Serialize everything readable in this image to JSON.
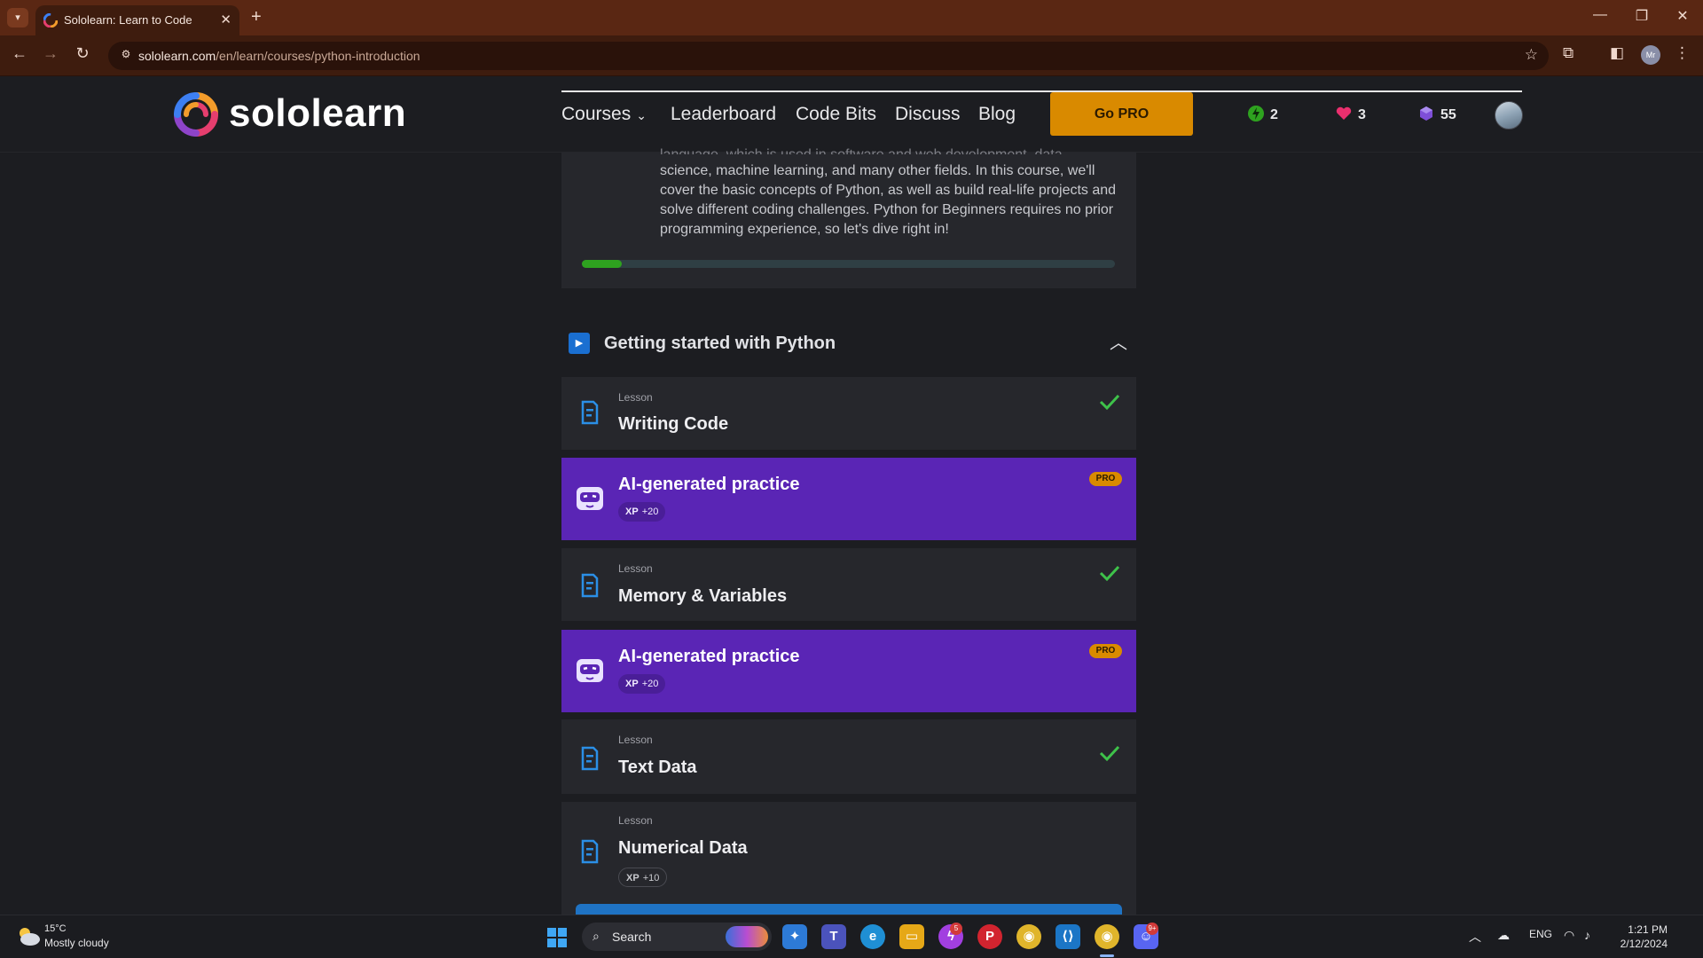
{
  "browser": {
    "tab_title": "Sololearn: Learn to Code",
    "url_host": "sololearn.com",
    "url_path": "/en/learn/courses/python-introduction",
    "profile_initials": "Mr"
  },
  "site": {
    "logo_text": "sololearn",
    "nav": [
      "Courses",
      "Leaderboard",
      "Code Bits",
      "Discuss",
      "Blog"
    ],
    "go_pro_label": "Go PRO",
    "stats": {
      "streak": "2",
      "hearts": "3",
      "gems": "55"
    }
  },
  "course": {
    "intro_cut_line": "language, which is used in software and web development, data",
    "intro_text": "science, machine learning, and many other fields. In this course, we'll cover the basic concepts of Python, as well as build real-life projects and solve different coding challenges. Python for Beginners requires no prior programming experience, so let's dive right in!",
    "progress_fraction": 0.075,
    "module_title": "Getting started with Python",
    "items": [
      {
        "kind": "Lesson",
        "title": "Writing Code",
        "completed": true
      },
      {
        "title": "AI-generated practice",
        "badge": "PRO",
        "xp_label": "XP",
        "xp_value": "+20"
      },
      {
        "kind": "Lesson",
        "title": "Memory & Variables",
        "completed": true
      },
      {
        "title": "AI-generated practice",
        "badge": "PRO",
        "xp_label": "XP",
        "xp_value": "+20"
      },
      {
        "kind": "Lesson",
        "title": "Text Data",
        "completed": true
      },
      {
        "kind": "Lesson",
        "title": "Numerical Data",
        "xp_label": "XP",
        "xp_value": "+10"
      }
    ]
  },
  "taskbar": {
    "weather_temp": "15°C",
    "weather_desc": "Mostly cloudy",
    "search_label": "Search",
    "messenger_badge": "5",
    "discord_badge": "9+",
    "time": "1:21 PM",
    "date": "2/12/2024",
    "lang": "ENG"
  },
  "colors": {
    "brand_orange": "#d98a00",
    "ai_purple": "#5a25b5",
    "progress_green": "#2ea21f",
    "lesson_blue": "#1a6fd1",
    "check_green": "#3ec24a",
    "heart_pink": "#ea2f6e"
  }
}
